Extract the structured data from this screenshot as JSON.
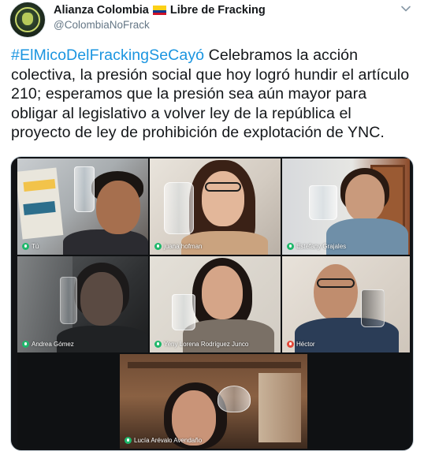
{
  "tweet": {
    "display_name_prefix": "Alianza Colombia",
    "display_name_suffix": "Libre de Fracking",
    "handle": "@ColombiaNoFrack",
    "hashtag": "#ElMicoDelFrackingSeCayó",
    "body": " Celebramos la acción colectiva, la presión social que hoy logró hundir el artículo 210; esperamos que la presión sea aún mayor para obligar al legislativo a volver ley de la república el proyecto de ley de prohibición de explotación de YNC."
  },
  "video_call": {
    "participants": [
      {
        "name": "Tú",
        "mic": "on"
      },
      {
        "name": "juana hofman",
        "mic": "on"
      },
      {
        "name": "Estefany Grajales",
        "mic": "on"
      },
      {
        "name": "Andrea Gómez",
        "mic": "on"
      },
      {
        "name": "Yeny Lorena Rodríguez Junco",
        "mic": "on"
      },
      {
        "name": "Héctor",
        "mic": "off"
      },
      {
        "name": "Lucía Arévalo Avendaño",
        "mic": "on"
      }
    ]
  },
  "colors": {
    "hashtag": "#1b95e0",
    "handle": "#657786",
    "text": "#14171a",
    "mic_on": "#1fb86b",
    "mic_off": "#e24a3b"
  },
  "icons": {
    "caret": "chevron-down-icon",
    "flag": "colombia-flag-icon",
    "mic": "microphone-icon"
  }
}
